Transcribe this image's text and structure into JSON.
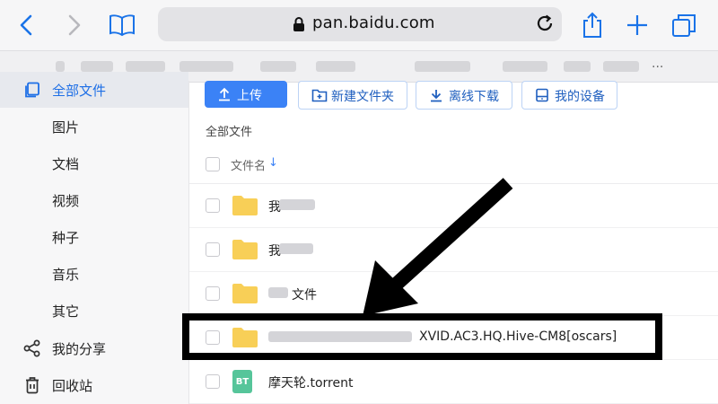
{
  "browser": {
    "url": "pan.baidu.com",
    "favorites_more": "..."
  },
  "toolbar": {
    "upload_label": "上传",
    "new_folder_label": "新建文件夹",
    "offline_download_label": "离线下载",
    "my_devices_label": "我的设备"
  },
  "sidebar": {
    "items": [
      {
        "label": "全部文件",
        "icon": "files-icon"
      },
      {
        "label": "图片"
      },
      {
        "label": "文档"
      },
      {
        "label": "视频"
      },
      {
        "label": "种子"
      },
      {
        "label": "音乐"
      },
      {
        "label": "其它"
      },
      {
        "label": "我的分享",
        "icon": "share-icon"
      },
      {
        "label": "回收站",
        "icon": "trash-icon"
      }
    ]
  },
  "main": {
    "breadcrumb": "全部文件",
    "column_header": "文件名",
    "files": [
      {
        "name_visible": "我",
        "type": "folder"
      },
      {
        "name_visible": "我",
        "type": "folder"
      },
      {
        "name_visible": "文件",
        "type": "folder"
      },
      {
        "name_visible": "XVID.AC3.HQ.Hive-CM8[oscars]",
        "type": "folder"
      },
      {
        "name_visible": "摩天轮.torrent",
        "type": "torrent",
        "badge": "BT"
      }
    ]
  },
  "colors": {
    "accent": "#3b82f6",
    "folder": "#f8cf57",
    "torrent": "#56c59a"
  }
}
